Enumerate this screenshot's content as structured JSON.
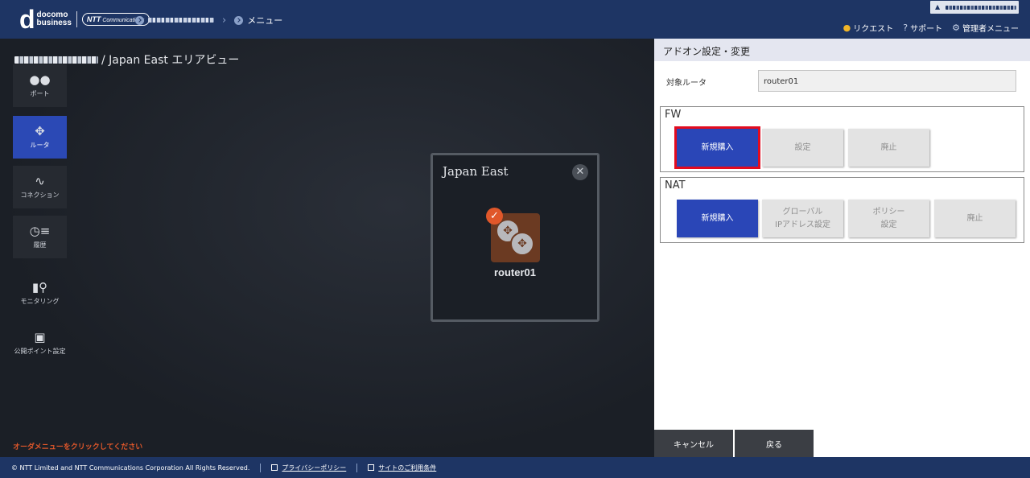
{
  "header": {
    "logo_mark": "d",
    "logo_line1": "docomo",
    "logo_line2": "business",
    "ntt_logo_main": "NTT",
    "ntt_logo_sub": "Communications",
    "breadcrumb_menu": "メニュー",
    "links": [
      {
        "label": "リクエスト",
        "icon": "bell-icon"
      },
      {
        "label": "サポート",
        "icon": "help-icon"
      },
      {
        "label": "管理者メニュー",
        "icon": "gear-icon"
      }
    ]
  },
  "main": {
    "area_title": "/ Japan East エリアビュー",
    "sidebar": [
      {
        "label": "ポート",
        "icon": "port-icon"
      },
      {
        "label": "ルータ",
        "icon": "router-icon"
      },
      {
        "label": "コネクション",
        "icon": "connection-icon"
      },
      {
        "label": "履歴",
        "icon": "history-icon"
      },
      {
        "label": "モニタリング",
        "icon": "monitoring-icon"
      },
      {
        "label": "公開ポイント設定",
        "icon": "public-point-icon"
      }
    ],
    "notice": "オーダメニューをクリックしてください",
    "region": {
      "title": "Japan East",
      "close": "✕",
      "router_name": "router01"
    }
  },
  "panel": {
    "title": "アドオン設定・変更",
    "target_label": "対象ルータ",
    "target_value": "router01",
    "fw": {
      "title": "FW",
      "buttons": [
        "新規購入",
        "設定",
        "廃止"
      ]
    },
    "nat": {
      "title": "NAT",
      "buttons": [
        "新規購入",
        "グローバル\nIPアドレス設定",
        "ポリシー\n設定",
        "廃止"
      ]
    },
    "cancel_label": "キャンセル",
    "back_label": "戻る"
  },
  "footer": {
    "copyright": "© NTT Limited and NTT Communications Corporation All Rights Reserved.",
    "privacy": "プライバシーポリシー",
    "terms": "サイトのご利用条件"
  }
}
